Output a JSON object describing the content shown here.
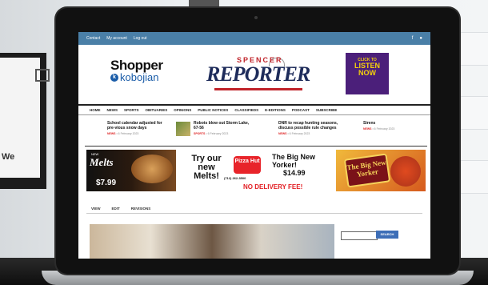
{
  "topbar": {
    "links": [
      "Contact",
      "My account",
      "Log out"
    ]
  },
  "header": {
    "shopper_title": "Shopper",
    "kobojian": "kobojian",
    "spencer": "SPENCER",
    "reporter": "REPORTER",
    "listen": {
      "line1": "CLICK TO",
      "line2": "LISTEN NOW"
    }
  },
  "nav": [
    "HOME",
    "NEWS",
    "SPORTS",
    "OBITUARIES",
    "OPINIONS",
    "PUBLIC NOTICES",
    "CLASSIFIEDS",
    "E-EDITIONS",
    "PODCAST",
    "SUBSCRIBE"
  ],
  "news": [
    {
      "headline": "School calendar adjusted for pre-vious snow days",
      "tag": "NEWS",
      "date": "• 6 February 2023"
    },
    {
      "headline": "Robots blow out Storm Lake, 67-56",
      "tag": "SPORTS",
      "date": "• 6 February 2023"
    },
    {
      "headline": "DNR to recap hunting seasons, discuss possible rule changes",
      "tag": "NEWS",
      "date": "• 6 February 2023"
    },
    {
      "headline": "Sirens",
      "tag": "NEWS",
      "date": "• 6 February 2023"
    }
  ],
  "ads": {
    "melts": {
      "new": "NEW",
      "title": "Melts",
      "price": "$7.99"
    },
    "pizzahut": {
      "try": "Try our new Melts!",
      "brand": "Pizza Hut",
      "phone": "(712) 262-3500",
      "big": "The Big New Yorker!",
      "price": "$14.99",
      "nodelivery": "NO DELIVERY FEE!"
    },
    "bigny": {
      "logo": "The Big New Yorker"
    }
  },
  "tabs": [
    "VIEW",
    "EDIT",
    "REVISIONS"
  ],
  "search": {
    "button": "SEARCH"
  },
  "background": {
    "left_label": "We"
  }
}
